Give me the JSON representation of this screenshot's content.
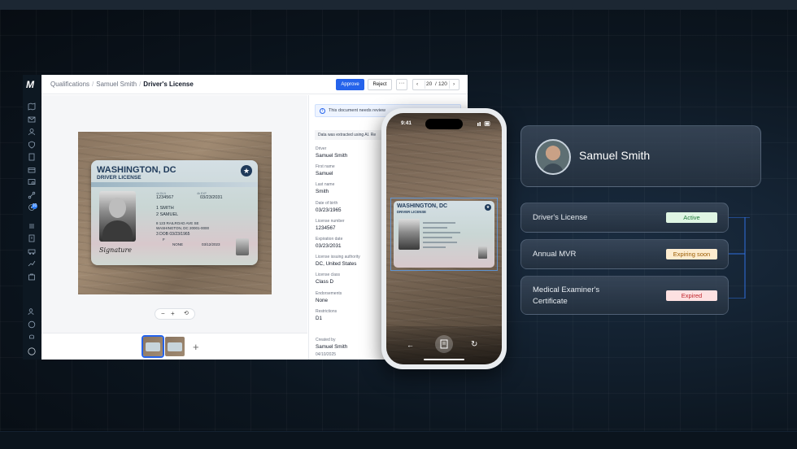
{
  "app": {
    "rail_logo": "M",
    "breadcrumb": {
      "root": "Qualifications",
      "person": "Samuel Smith",
      "current": "Driver's License"
    },
    "toolbar": {
      "approve": "Approve",
      "reject": "Reject",
      "more": "···",
      "page_current": "20",
      "page_sep": "/",
      "page_total": "120",
      "prev": "‹",
      "next": "›"
    },
    "rail_badge": "10",
    "zoom": {
      "out": "−",
      "in": "+"
    },
    "add_thumb": "+",
    "panel": {
      "review_notice": "This document needs review",
      "extracted_notice": "Data was extracted using AI. Re",
      "fields": [
        {
          "label": "Driver",
          "value": "Samuel Smith"
        },
        {
          "label": "First name",
          "value": "Samuel"
        },
        {
          "label": "Last name",
          "value": "Smith"
        },
        {
          "label": "Date of birth",
          "value": "03/23/1965"
        },
        {
          "label": "License number",
          "value": "1234567"
        },
        {
          "label": "Expiration date",
          "value": "03/23/2031"
        },
        {
          "label": "License issuing authority",
          "value": "DC, United States"
        },
        {
          "label": "License class",
          "value": "Class D"
        },
        {
          "label": "Endorsements",
          "value": "None"
        },
        {
          "label": "Restrictions",
          "value": "D1"
        }
      ],
      "created_label": "Created by",
      "created_by": "Samuel Smith",
      "created_date": "04/10/2025"
    }
  },
  "license": {
    "title": "WASHINGTON, DC",
    "subtitle": "DRIVER LICENSE",
    "dl_label": "4d DLN",
    "dl": "1234567",
    "exp_label": "4b EXP",
    "exp": "03/23/2031",
    "last": "1 SMITH",
    "first": "2 SAMUEL",
    "addr1": "8 123 RAILROAD AVE SE",
    "addr2": "WASHINGTON, DC 20001-0000",
    "dob": "3 DOB 03/23/1965",
    "f1": "F",
    "f2": "NONE",
    "f3": "03/12/2023",
    "signature": "Signature"
  },
  "phone": {
    "time": "9:41",
    "card_title": "WASHINGTON, DC",
    "card_subtitle": "DRIVER LICENSE",
    "back": "←",
    "rotate": "↻"
  },
  "profile": {
    "name": "Samuel Smith"
  },
  "qualifications": [
    {
      "name": "Driver's License",
      "status": "Active",
      "status_color": "#1f7a3a"
    },
    {
      "name": "Annual MVR",
      "status": "Expiring soon",
      "status_color": "#9a5b00"
    },
    {
      "name": "Medical Examiner's Certificate",
      "status": "Expired",
      "status_color": "#c0262d"
    }
  ],
  "colors": {
    "accent": "#2563eb",
    "connector": "#2f6fe0"
  }
}
